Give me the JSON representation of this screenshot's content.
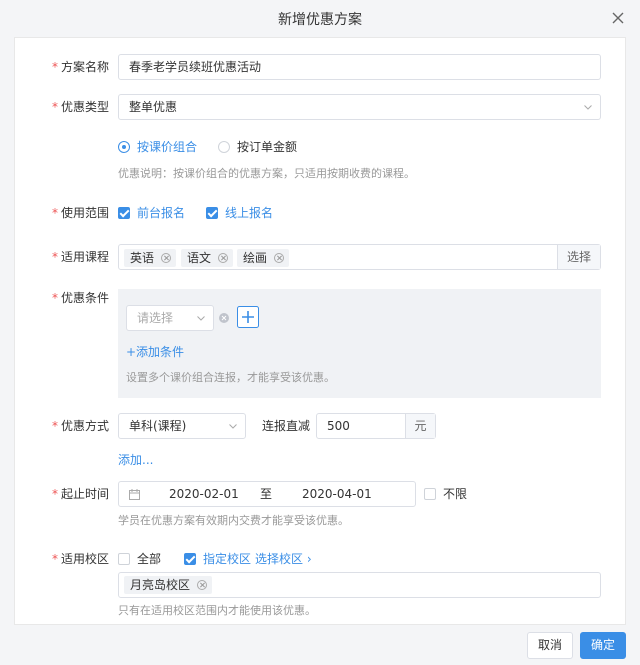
{
  "dialog": {
    "title": "新增优惠方案",
    "cancel_label": "取消",
    "ok_label": "确定"
  },
  "form": {
    "plan_name": {
      "label": "方案名称",
      "value": "春季老学员续班优惠活动"
    },
    "discount_type": {
      "label": "优惠类型",
      "value": "整单优惠",
      "radio_options": [
        "按课价组合",
        "按订单金额"
      ],
      "selected_radio": "按课价组合",
      "hint": "优惠说明：按课价组合的优惠方案，只适用按期收费的课程。"
    },
    "scope": {
      "label": "使用范围",
      "options": [
        {
          "label": "前台报名",
          "checked": true
        },
        {
          "label": "线上报名",
          "checked": true
        }
      ]
    },
    "courses": {
      "label": "适用课程",
      "tags": [
        "英语",
        "语文",
        "绘画"
      ],
      "select_button": "选择"
    },
    "conditions": {
      "label": "优惠条件",
      "select_placeholder": "请选择",
      "add_label": "+添加条件",
      "hint": "设置多个课价组合连报，才能享受该优惠。"
    },
    "method": {
      "label": "优惠方式",
      "select_value": "单科(课程)",
      "rule_label": "连报直减",
      "amount": "500",
      "unit": "元",
      "add_label": "添加..."
    },
    "period": {
      "label": "起止时间",
      "start": "2020-02-01",
      "separator": "至",
      "end": "2020-04-01",
      "unlimited_label": "不限",
      "unlimited_checked": false,
      "hint": "学员在优惠方案有效期内交费才能享受该优惠。"
    },
    "campus": {
      "label": "适用校区",
      "all_label": "全部",
      "all_checked": false,
      "specified_label": "指定校区",
      "specified_checked": true,
      "choose_label": "选择校区 ›",
      "tags": [
        "月亮岛校区"
      ],
      "hint": "只有在适用校区范围内才能使用该优惠。"
    }
  },
  "colors": {
    "accent": "#3a8ee6",
    "required": "#ee5555"
  }
}
